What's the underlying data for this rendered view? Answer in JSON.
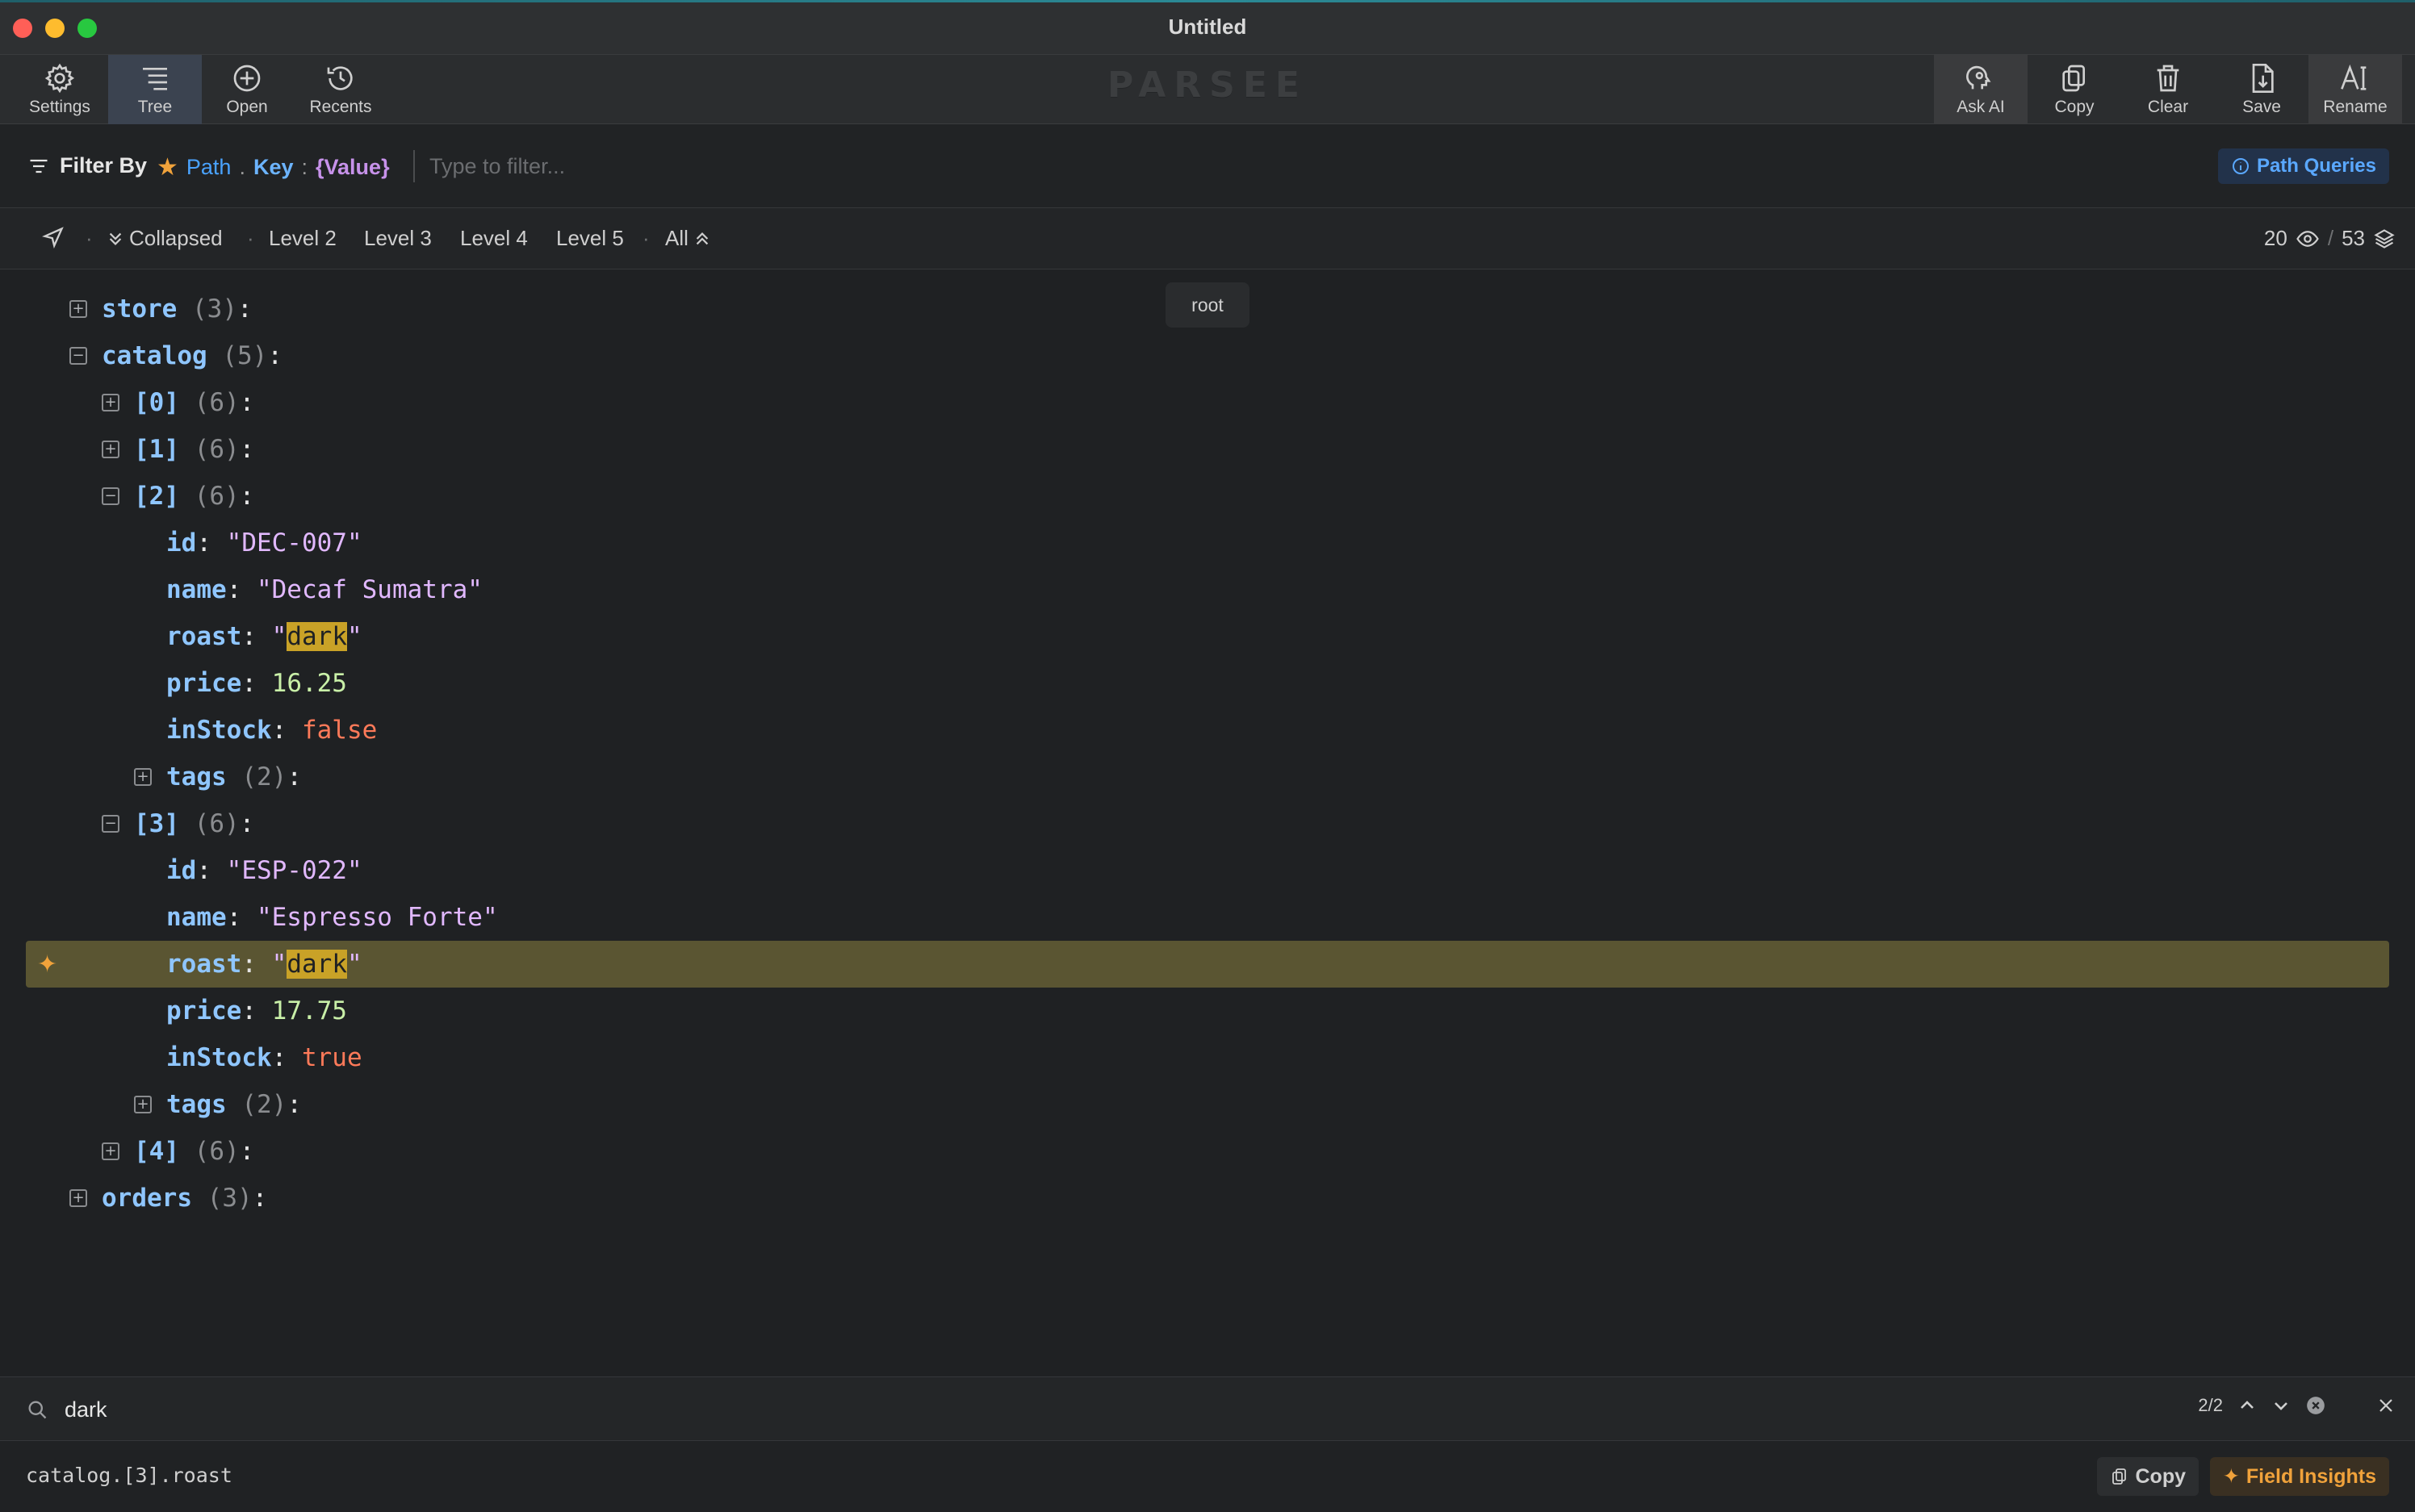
{
  "window": {
    "title": "Untitled"
  },
  "toolbar": {
    "left": [
      {
        "label": "Settings",
        "icon": "gear-icon"
      },
      {
        "label": "Tree",
        "icon": "tree-list-icon"
      },
      {
        "label": "Open",
        "icon": "plus-circle-icon"
      },
      {
        "label": "Recents",
        "icon": "history-icon"
      }
    ],
    "brand": "PARSEE",
    "right": [
      {
        "label": "Ask AI",
        "icon": "ai-head-icon"
      },
      {
        "label": "Copy",
        "icon": "copy-icon"
      },
      {
        "label": "Clear",
        "icon": "trash-icon"
      },
      {
        "label": "Save",
        "icon": "save-icon"
      },
      {
        "label": "Rename",
        "icon": "rename-icon"
      }
    ]
  },
  "filter": {
    "label": "Filter By",
    "path": "Path",
    "dot": ".",
    "key": "Key",
    "colon": ":",
    "value": "{Value}",
    "placeholder": "Type to filter...",
    "path_queries": "Path Queries"
  },
  "levels": {
    "collapsed": "Collapsed",
    "items": [
      "Level 2",
      "Level 3",
      "Level 4",
      "Level 5"
    ],
    "all": "All",
    "visible_count": "20",
    "total_count": "53"
  },
  "tooltip": "root",
  "tree": {
    "store_key": "store",
    "store_count": "(3)",
    "catalog_key": "catalog",
    "catalog_count": "(5)",
    "i0_key": "[0]",
    "i0_count": "(6)",
    "i1_key": "[1]",
    "i1_count": "(6)",
    "i2_key": "[2]",
    "i2_count": "(6)",
    "i2_id": "\"DEC-007\"",
    "i2_name": "\"Decaf Sumatra\"",
    "i2_roast": "dark",
    "i2_price": "16.25",
    "i2_instock": "false",
    "i2_tags_count": "(2)",
    "i3_key": "[3]",
    "i3_count": "(6)",
    "i3_id": "\"ESP-022\"",
    "i3_name": "\"Espresso Forte\"",
    "i3_roast": "dark",
    "i3_price": "17.75",
    "i3_instock": "true",
    "i3_tags_count": "(2)",
    "i4_key": "[4]",
    "i4_count": "(6)",
    "orders_key": "orders",
    "orders_count": "(3)",
    "field_id": "id",
    "field_name": "name",
    "field_roast": "roast",
    "field_price": "price",
    "field_instock": "inStock",
    "field_tags": "tags"
  },
  "search": {
    "value": "dark",
    "match_counter": "2/2"
  },
  "status": {
    "path": "catalog.[3].roast",
    "copy_label": "Copy",
    "insights_label": "Field Insights"
  }
}
